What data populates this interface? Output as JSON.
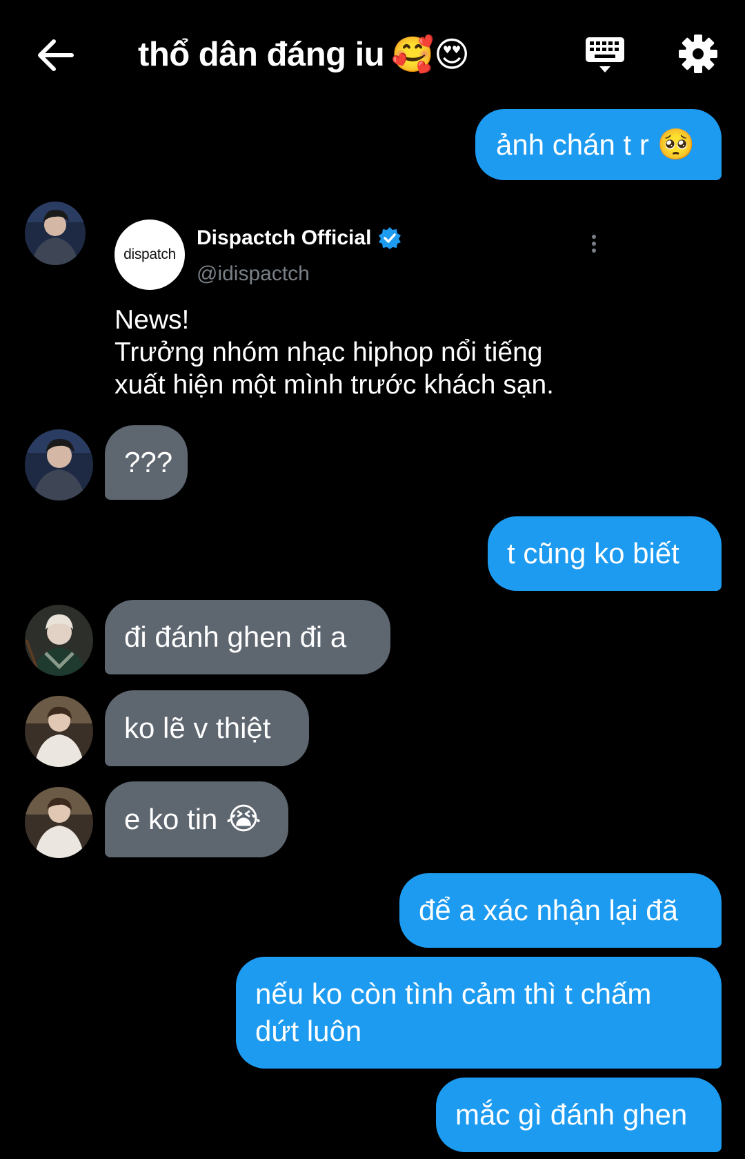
{
  "header": {
    "title": "thổ dân đáng iu",
    "title_emoji": "🥰😍"
  },
  "tweet": {
    "logo_text": "dispatch",
    "name": "Dispactch Official",
    "handle": "@idispactch",
    "lines": [
      "News!",
      "Trưởng nhóm nhạc hiphop nổi tiếng",
      "xuất hiện một mình trước khách sạn."
    ]
  },
  "messages": [
    {
      "direction": "outgoing",
      "text": "ảnh chán t r",
      "emoji": "🥺"
    },
    {
      "direction": "incoming",
      "text": "???"
    },
    {
      "direction": "outgoing",
      "text": "t cũng ko biết"
    },
    {
      "direction": "incoming",
      "text": "đi đánh ghen đi a"
    },
    {
      "direction": "incoming",
      "text": "ko lẽ v thiệt"
    },
    {
      "direction": "incoming",
      "text": "e ko tin",
      "emoji": "😭"
    },
    {
      "direction": "outgoing",
      "text": "để a xác nhận lại đã"
    },
    {
      "direction": "outgoing",
      "text_line1": "nếu ko còn tình cảm thì t chấm",
      "text_line2": "dứt luôn"
    },
    {
      "direction": "outgoing",
      "text": "mắc gì đánh ghen"
    }
  ],
  "colors": {
    "background": "#000000",
    "outgoing_bubble": "#1d9bf0",
    "incoming_bubble": "#5e6670",
    "verified": "#1d9bf0",
    "handle_text": "#7a8087"
  },
  "icons": {
    "back": "arrow-left-icon",
    "keyboard": "keyboard-icon",
    "settings": "gear-icon",
    "verified": "verified-badge-icon",
    "more": "more-vertical-icon"
  }
}
